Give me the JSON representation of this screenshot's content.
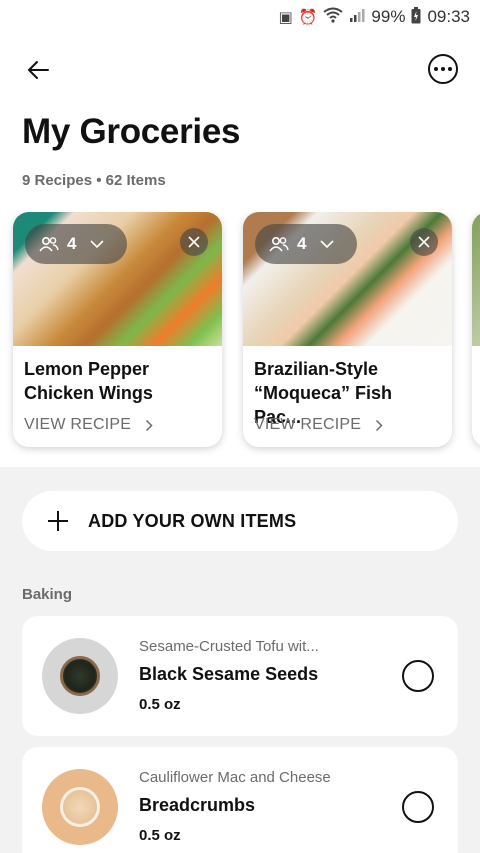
{
  "status_bar": {
    "battery": "99%",
    "time": "09:33"
  },
  "page": {
    "title": "My Groceries",
    "subtitle": "9 Recipes • 62 Items"
  },
  "recipes": [
    {
      "servings": "4",
      "title": "Lemon Pepper Chicken Wings",
      "link": "VIEW RECIPE"
    },
    {
      "servings": "4",
      "title": "Brazilian-Style “Moqueca” Fish Pac...",
      "link": "VIEW RECIPE"
    }
  ],
  "add_own": {
    "label": "ADD YOUR OWN ITEMS"
  },
  "sections": [
    {
      "label": "Baking",
      "items": [
        {
          "recipe": "Sesame-Crusted Tofu wit...",
          "name": "Black Sesame Seeds",
          "qty": "0.5 oz"
        },
        {
          "recipe": "Cauliflower Mac and Cheese",
          "name": "Breadcrumbs",
          "qty": "0.5 oz"
        }
      ]
    }
  ]
}
